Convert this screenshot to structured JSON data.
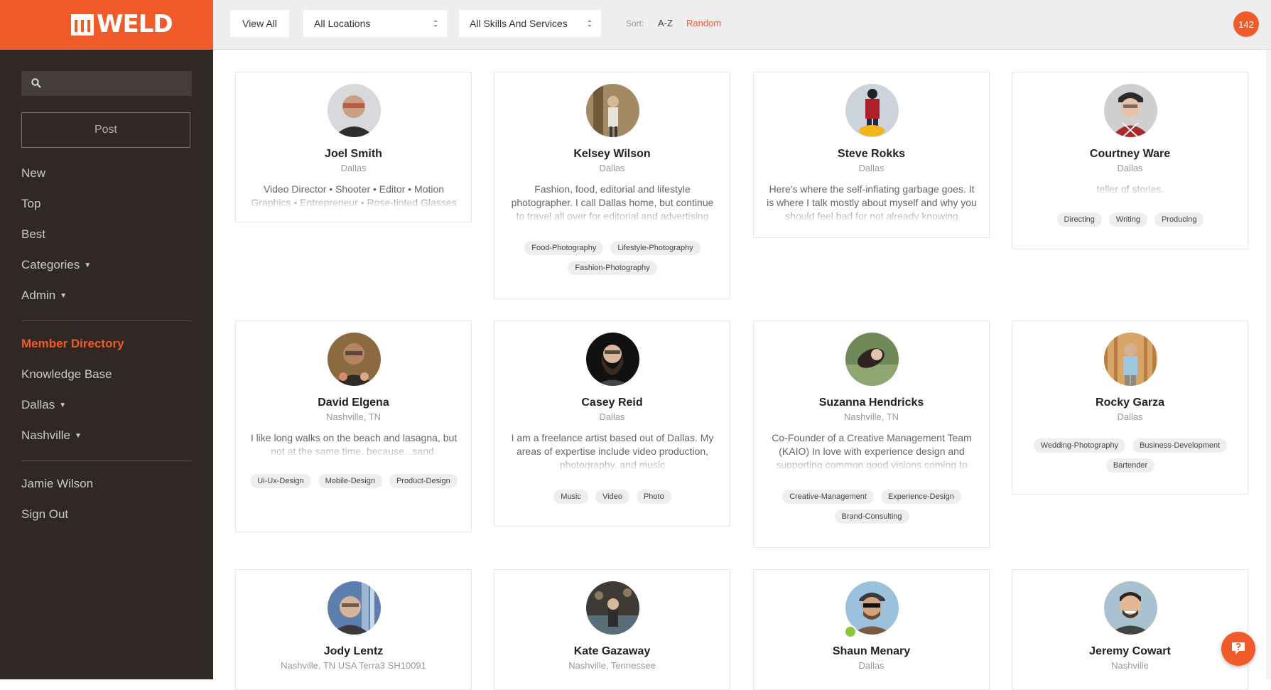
{
  "app": {
    "logo_text": "WELD"
  },
  "sidebar": {
    "search_placeholder": "",
    "post_label": "Post",
    "nav": [
      {
        "label": "New"
      },
      {
        "label": "Top"
      },
      {
        "label": "Best"
      },
      {
        "label": "Categories",
        "caret": "▼"
      },
      {
        "label": "Admin",
        "caret": "▼"
      }
    ],
    "sections": [
      {
        "label": "Member Directory",
        "active": true
      },
      {
        "label": "Knowledge Base"
      },
      {
        "label": "Dallas",
        "caret": "▼"
      },
      {
        "label": "Nashville",
        "caret": "▼"
      }
    ],
    "account": [
      {
        "label": "Jamie Wilson"
      },
      {
        "label": "Sign Out"
      }
    ]
  },
  "toolbar": {
    "view_all": "View All",
    "location_select": "All Locations",
    "skills_select": "All Skills And Services",
    "sort_label": "Sort:",
    "sort_az": "A-Z",
    "sort_random": "Random",
    "count": "142"
  },
  "colors": {
    "accent": "#f15a29",
    "sidebar": "#2f2825",
    "topbar": "#eeeeee"
  },
  "members": [
    {
      "name": "Joel Smith",
      "location": "Dallas",
      "bio": "Video Director • Shooter • Editor • Motion Graphics • Entrepreneur • Rose-tinted Glasses",
      "tags": []
    },
    {
      "name": "Kelsey Wilson",
      "location": "Dallas",
      "bio": "Fashion, food, editorial and lifestyle photographer. I call Dallas home, but continue to travel all over for editorial and advertising",
      "tags": [
        "Food-Photography",
        "Lifestyle-Photography",
        "Fashion-Photography"
      ]
    },
    {
      "name": "Steve Rokks",
      "location": "Dallas",
      "bio": "Here's where the self-inflating garbage goes. It is where I talk mostly about myself and why you should feel bad for not already knowing",
      "tags": []
    },
    {
      "name": "Courtney Ware",
      "location": "Dallas",
      "bio": "teller of stories.",
      "tags": [
        "Directing",
        "Writing",
        "Producing"
      ]
    },
    {
      "name": "David Elgena",
      "location": "Nashville, TN",
      "bio": "I like long walks on the beach and lasagna, but not at the same time, because...sand.",
      "tags": [
        "Ui-Ux-Design",
        "Mobile-Design",
        "Product-Design"
      ]
    },
    {
      "name": "Casey Reid",
      "location": "Dallas",
      "bio": "I am a freelance artist based out of Dallas. My areas of expertise include video production, photography, and music",
      "tags": [
        "Music",
        "Video",
        "Photo"
      ]
    },
    {
      "name": "Suzanna Hendricks",
      "location": "Nashville, TN",
      "bio": "Co-Founder of a Creative Management Team (KAIO) In love with experience design and supporting common good visions coming to",
      "tags": [
        "Creative-Management",
        "Experience-Design",
        "Brand-Consulting"
      ]
    },
    {
      "name": "Rocky Garza",
      "location": "Dallas",
      "bio": "",
      "tags": [
        "Wedding-Photography",
        "Business-Development",
        "Bartender"
      ]
    },
    {
      "name": "Jody Lentz",
      "location": "Nashville, TN USA Terra3 SH10091",
      "bio": "",
      "tags": []
    },
    {
      "name": "Kate Gazaway",
      "location": "Nashville, Tennessee",
      "bio": "",
      "tags": []
    },
    {
      "name": "Shaun Menary",
      "location": "Dallas",
      "bio": "",
      "tags": []
    },
    {
      "name": "Jeremy Cowart",
      "location": "Nashville",
      "bio": "",
      "tags": []
    }
  ]
}
